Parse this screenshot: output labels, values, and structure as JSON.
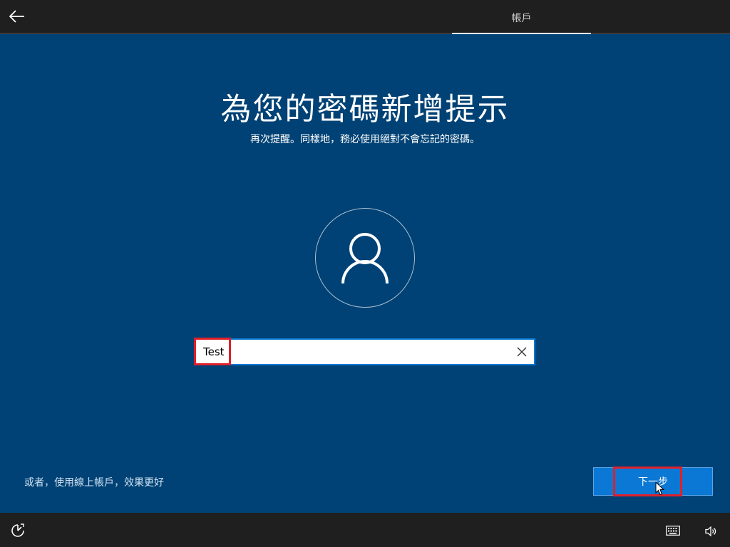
{
  "header": {
    "back_icon": "back-arrow-icon",
    "tab_label": "帳戶"
  },
  "main": {
    "title": "為您的密碼新增提示",
    "subtitle": "再次提醒。同樣地，務必使用絕對不會忘記的密碼。",
    "avatar_icon": "user-icon"
  },
  "hint_field": {
    "value": "Test",
    "placeholder": "",
    "clear_icon": "close-icon"
  },
  "footer": {
    "online_account_link": "或者，使用線上帳戶，效果更好",
    "next_label": "下一步"
  },
  "bottom_bar": {
    "ease_of_access_icon": "ease-of-access-icon",
    "keyboard_icon": "keyboard-icon",
    "volume_icon": "volume-icon"
  },
  "colors": {
    "background": "#004275",
    "bar": "#1f1f1f",
    "accent": "#0a78d4",
    "highlight": "#e0202a"
  }
}
